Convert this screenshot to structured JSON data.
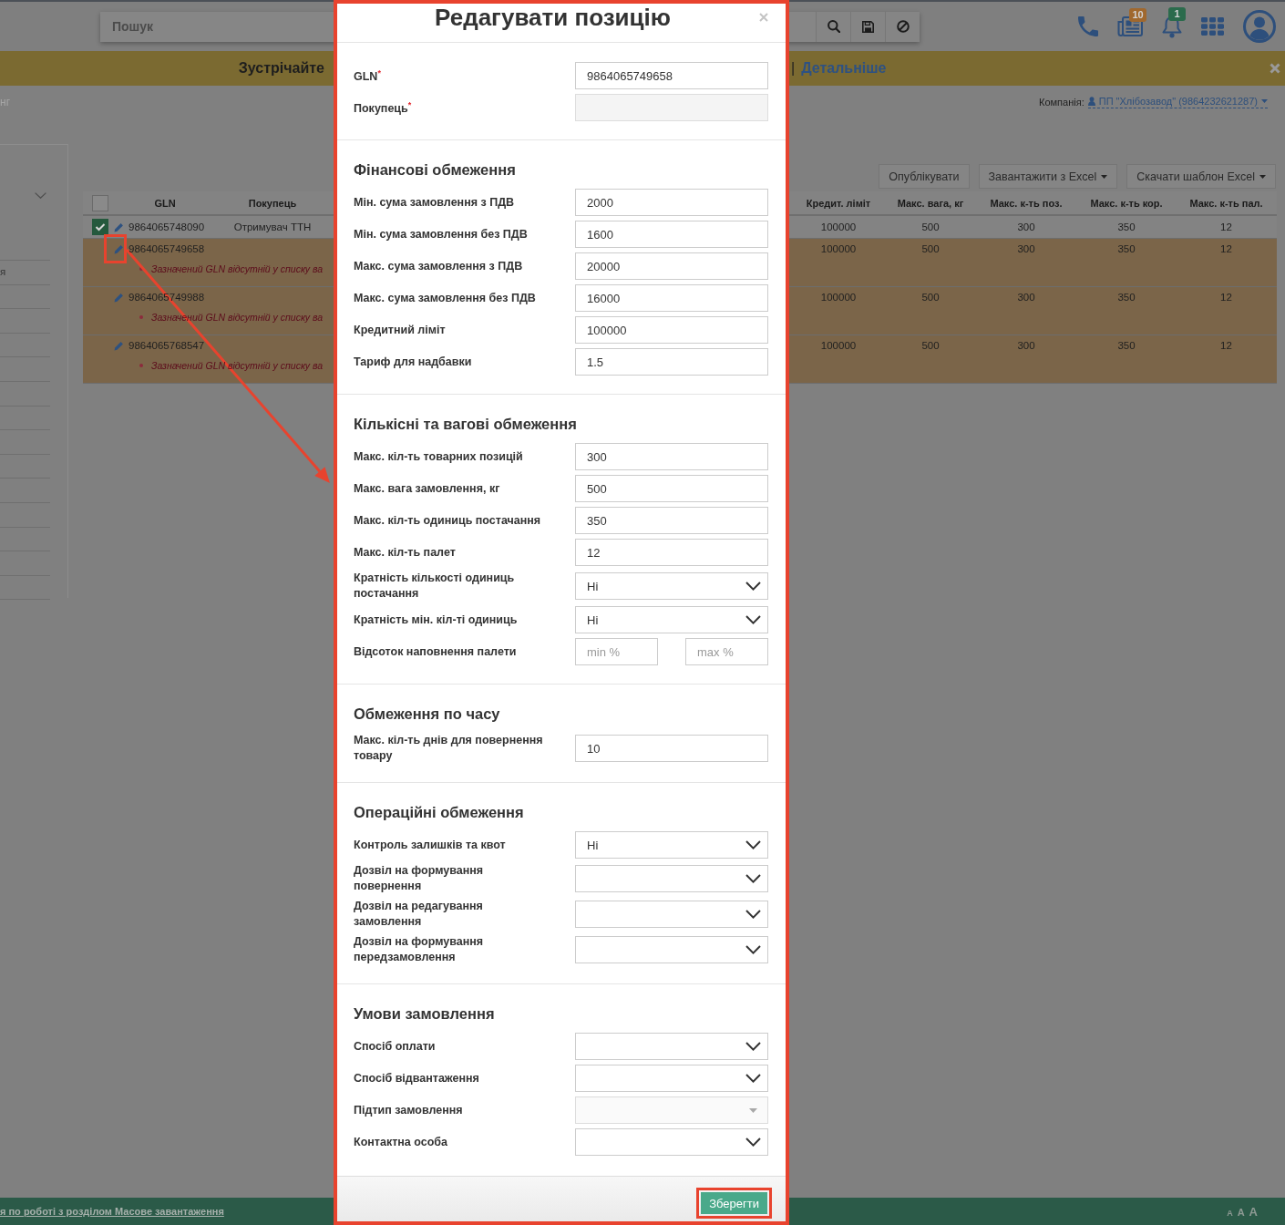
{
  "top_bar": {
    "search": {
      "placeholder": "Пошук"
    },
    "search_buttons": [
      {
        "kind": "search"
      },
      {
        "kind": "save"
      },
      {
        "kind": "cancel"
      }
    ],
    "icons": [
      {
        "kind": "phone"
      },
      {
        "kind": "news",
        "badge": "10",
        "color": "#a0682e"
      },
      {
        "kind": "bell",
        "badge": "1",
        "color": "#2b6b4c"
      },
      {
        "kind": "apps"
      },
      {
        "kind": "avatar"
      }
    ]
  },
  "banner": {
    "text": "Зустрічайте",
    "separator": "|",
    "link": "Детальніше"
  },
  "breadcrumb": {
    "text": "нг",
    "company_label": "Компанія:",
    "company": "ПП \"Хлібозавод\" (9864232621287)"
  },
  "sidebar": {
    "items": [
      {
        "label": "я"
      }
    ]
  },
  "toolbar": {
    "buttons": [
      {
        "label": "Опублікувати",
        "dropdown": false
      },
      {
        "label": "Завантажити з Excel",
        "dropdown": true
      },
      {
        "label": "Скачати шаблон Excel",
        "dropdown": true
      }
    ]
  },
  "table": {
    "header_checkbox": {
      "checked": false
    },
    "columns": [
      "GLN",
      "Покупець",
      "Кредит. ліміт",
      "Макс. вага, кг",
      "Макс. к-ть поз.",
      "Макс. к-ть кор.",
      "Макс. к-ть пал."
    ],
    "rows": [
      {
        "kind": "valid",
        "checked": true,
        "highlighted": false,
        "gln": "9864065748090",
        "buyer": "Отримувач ТТН",
        "values": [
          "100000",
          "500",
          "300",
          "350",
          "12"
        ]
      },
      {
        "kind": "error",
        "highlighted": true,
        "gln": "9864065749658",
        "values": [
          "100000",
          "500",
          "300",
          "350",
          "12"
        ],
        "error": "Зазначений GLN відсутній у списку ва"
      },
      {
        "kind": "error",
        "highlighted": false,
        "gln": "9864065749988",
        "values": [
          "100000",
          "500",
          "300",
          "350",
          "12"
        ],
        "error": "Зазначений GLN відсутній у списку ва"
      },
      {
        "kind": "error",
        "highlighted": false,
        "gln": "9864065768547",
        "values": [
          "100000",
          "500",
          "300",
          "350",
          "12"
        ],
        "error": "Зазначений GLN відсутній у списку ва"
      }
    ]
  },
  "footer": {
    "link": "я по роботі з розділом Масове завантаження",
    "font_sizes": [
      "A",
      "A",
      "A"
    ]
  },
  "modal": {
    "title": "Редагувати позицію",
    "highlighted": true,
    "sections": [
      {
        "fields": [
          {
            "kind": "text",
            "label": "GLN$^{*}$",
            "value": "9864065749658",
            "disabled": false
          },
          {
            "kind": "text",
            "label": "Покупець$^{*}$",
            "disabled": true
          }
        ]
      },
      {
        "title": "Фінансові обмеження",
        "fields": [
          {
            "kind": "text",
            "label": "Мін. сума замовлення з ПДВ",
            "value": "2000",
            "disabled": false
          },
          {
            "kind": "text",
            "label": "Мін. сума замовлення без ПДВ",
            "value": "1600",
            "disabled": false
          },
          {
            "kind": "text",
            "label": "Макс. сума замовлення з ПДВ",
            "value": "20000",
            "disabled": false
          },
          {
            "kind": "text",
            "label": "Макс. сума замовлення без ПДВ",
            "value": "16000",
            "disabled": false
          },
          {
            "kind": "text",
            "label": "Кредитний ліміт",
            "value": "100000",
            "disabled": false
          },
          {
            "kind": "text",
            "label": "Тариф для надбавки",
            "value": "1.5",
            "disabled": false
          }
        ]
      },
      {
        "title": "Кількісні та вагові обмеження",
        "fields": [
          {
            "kind": "text",
            "label": "Макс. кіл-ть товарних позицій",
            "value": "300",
            "disabled": false
          },
          {
            "kind": "text",
            "label": "Макс. вага замовлення, кг",
            "value": "500",
            "disabled": false
          },
          {
            "kind": "text",
            "label": "Макс. кіл-ть одиниць постачання",
            "value": "350",
            "disabled": false
          },
          {
            "kind": "text",
            "label": "Макс. кіл-ть палет",
            "value": "12",
            "disabled": false
          },
          {
            "kind": "select",
            "label": "Кратність кількості одиниць постачання",
            "value": "Ні",
            "disabled": false
          },
          {
            "kind": "select",
            "label": "Кратність мін. кіл-ті одиниць",
            "value": "Ні",
            "disabled": false
          },
          {
            "kind": "range",
            "label": "Відсоток наповнення палети",
            "min_placeholder": "min %",
            "max_placeholder": "max %",
            "disabled": false
          }
        ]
      },
      {
        "title": "Обмеження по часу",
        "fields": [
          {
            "kind": "text",
            "label": "Макс. кіл-ть днів для повернення товару",
            "value": "10",
            "disabled": false
          }
        ]
      },
      {
        "title": "Операційні обмеження",
        "fields": [
          {
            "kind": "select",
            "label": "Контроль залишків та квот",
            "value": "Ні",
            "disabled": false
          },
          {
            "kind": "select",
            "label": "Дозвіл на формування повернення",
            "disabled": false
          },
          {
            "kind": "select",
            "label": "Дозвіл на редагування замовлення",
            "disabled": false
          },
          {
            "kind": "select",
            "label": "Дозвіл на формування передзамовлення",
            "disabled": false
          }
        ]
      },
      {
        "title": "Умови замовлення",
        "fields": [
          {
            "kind": "select",
            "label": "Спосіб оплати",
            "disabled": false
          },
          {
            "kind": "select",
            "label": "Спосіб відвантаження",
            "disabled": false
          },
          {
            "kind": "select",
            "label": "Підтип замовлення",
            "disabled": true
          },
          {
            "kind": "select",
            "label": "Контактна особа",
            "disabled": false
          }
        ]
      }
    ],
    "save_button": {
      "label": "Зберегти",
      "highlighted": true
    }
  }
}
